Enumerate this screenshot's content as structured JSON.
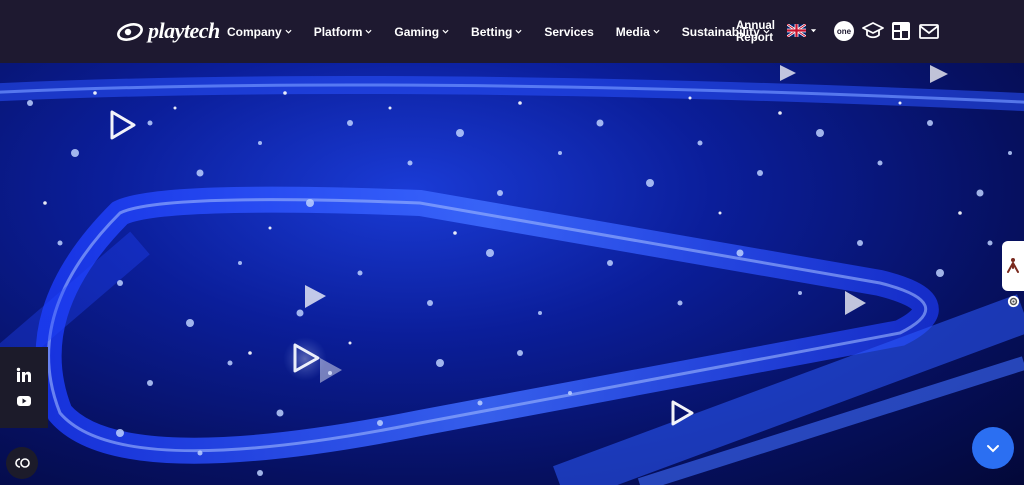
{
  "brand": {
    "logo_text": "playtech"
  },
  "nav": {
    "items": [
      {
        "label": "Company",
        "has_dropdown": true
      },
      {
        "label": "Platform",
        "has_dropdown": true
      },
      {
        "label": "Gaming",
        "has_dropdown": true
      },
      {
        "label": "Betting",
        "has_dropdown": true
      },
      {
        "label": "Services",
        "has_dropdown": false
      },
      {
        "label": "Media",
        "has_dropdown": true
      },
      {
        "label": "Sustainability",
        "has_dropdown": true
      }
    ],
    "annual_report_line1": "Annual",
    "annual_report_line2": "Report"
  },
  "header_icons": [
    "language-flag-uk-icon",
    "one-icon",
    "graduation-cap-icon",
    "calendar-icon",
    "mail-icon"
  ],
  "social": [
    "linkedin-icon",
    "youtube-icon"
  ],
  "colors": {
    "header_bg": "#1e1930",
    "accent_blue": "#2b6ff2",
    "hero_blue": "#0b1e9a"
  }
}
